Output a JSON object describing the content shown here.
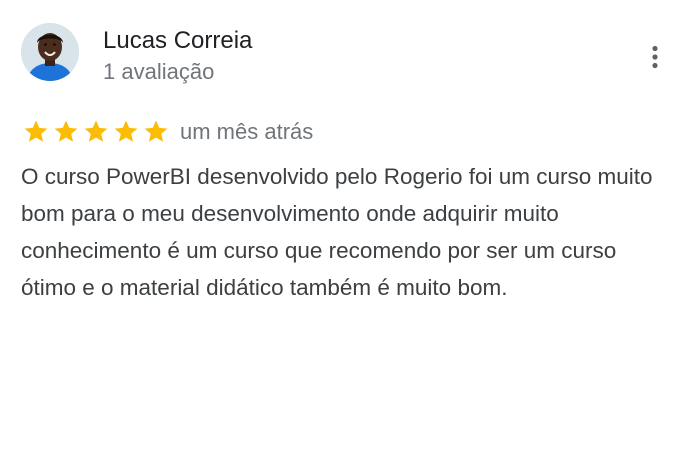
{
  "reviewer": {
    "name": "Lucas Correia",
    "review_count": "1 avaliação"
  },
  "rating": {
    "stars": 5,
    "max": 5,
    "color": "#fbbc04"
  },
  "date": "um mês atrás",
  "text": "O curso PowerBI desenvolvido pelo Rogerio foi um curso muito bom para o meu desenvolvimento onde adquirir muito conhecimento é um curso que recomendo por ser um curso ótimo e o material didático também é muito bom.",
  "menu_icon": "more-vert-icon"
}
